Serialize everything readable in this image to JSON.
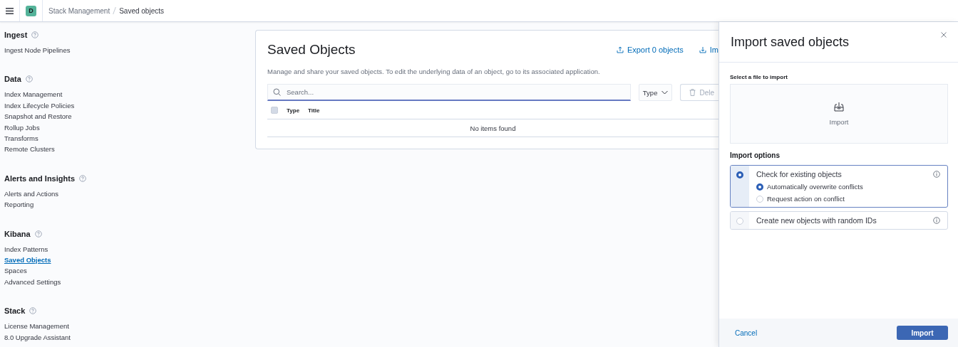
{
  "header": {
    "avatar": "D",
    "breadcrumbs": [
      "Stack Management",
      "Saved objects"
    ]
  },
  "sidebar": {
    "sections": [
      {
        "title": "Ingest",
        "items": [
          {
            "label": "Ingest Node Pipelines",
            "selected": false
          }
        ]
      },
      {
        "title": "Data",
        "items": [
          {
            "label": "Index Management",
            "selected": false
          },
          {
            "label": "Index Lifecycle Policies",
            "selected": false
          },
          {
            "label": "Snapshot and Restore",
            "selected": false
          },
          {
            "label": "Rollup Jobs",
            "selected": false
          },
          {
            "label": "Transforms",
            "selected": false
          },
          {
            "label": "Remote Clusters",
            "selected": false
          }
        ]
      },
      {
        "title": "Alerts and Insights",
        "items": [
          {
            "label": "Alerts and Actions",
            "selected": false
          },
          {
            "label": "Reporting",
            "selected": false
          }
        ]
      },
      {
        "title": "Kibana",
        "items": [
          {
            "label": "Index Patterns",
            "selected": false
          },
          {
            "label": "Saved Objects",
            "selected": true
          },
          {
            "label": "Spaces",
            "selected": false
          },
          {
            "label": "Advanced Settings",
            "selected": false
          }
        ]
      },
      {
        "title": "Stack",
        "items": [
          {
            "label": "License Management",
            "selected": false
          },
          {
            "label": "8.0 Upgrade Assistant",
            "selected": false
          }
        ]
      }
    ]
  },
  "page": {
    "title": "Saved Objects",
    "export_button": "Export 0 objects",
    "import_button": "Im",
    "description": "Manage and share your saved objects. To edit the underlying data of an object, go to its associated application.",
    "search": {
      "placeholder": "Search..."
    },
    "type_filter": "Type",
    "delete_button": "Dele",
    "table": {
      "select_all_checked": false,
      "columns": [
        "Type",
        "Title"
      ],
      "empty_message": "No items found"
    }
  },
  "flyout": {
    "title": "Import saved objects",
    "file_label": "Select a file to import",
    "dropzone_label": "Import",
    "options_title": "Import options",
    "options": [
      {
        "label": "Check for existing objects",
        "selected": true,
        "children": [
          {
            "label": "Automatically overwrite conflicts",
            "selected": true
          },
          {
            "label": "Request action on conflict",
            "selected": false
          }
        ]
      },
      {
        "label": "Create new objects with random IDs",
        "selected": false
      }
    ],
    "cancel_button": "Cancel",
    "import_button": "Import"
  }
}
